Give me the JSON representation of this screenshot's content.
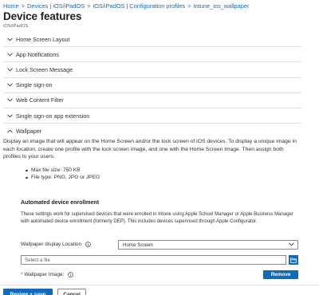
{
  "breadcrumb": {
    "items": [
      "Home",
      "Devices | iOS/iPadOS",
      "iOS/iPadOS | Configuration profiles",
      "Intune_ios_wallpaper"
    ],
    "separator": ">"
  },
  "page": {
    "title": "Device features",
    "subtitle": "iOS/iPadOS"
  },
  "sections": [
    {
      "label": "Home Screen Layout",
      "expanded": false
    },
    {
      "label": "App Notifications",
      "expanded": false
    },
    {
      "label": "Lock Screen Message",
      "expanded": false
    },
    {
      "label": "Single sign-on",
      "expanded": false
    },
    {
      "label": "Web Content Filter",
      "expanded": false
    },
    {
      "label": "Single sign-on app extension",
      "expanded": false
    },
    {
      "label": "Wallpaper",
      "expanded": true
    }
  ],
  "wallpaper": {
    "description": "Display an image that will appear on the Home Screen and/or the lock screen of iOS devices. To display a unique image in each location, create one profile with the lock screen image, and one with the Home Screen image. Then assign both profiles to your users.",
    "bullets": [
      "Max file size: 750 KB",
      "File type: PNG, JPG or JPEG"
    ]
  },
  "ade": {
    "heading": "Automated device enrollment",
    "description": "These settings work for supervised devices that were enrolled in Intune using Apple School Manager or Apple Business Manager with automated device enrollment (formerly DEP). This includes devices supervised through Apple Configurator.",
    "location_label": "Wallpaper display Location",
    "location_value": "Home Screen",
    "file_placeholder": "Select a file",
    "image_label": "Wallpaper Image:",
    "remove_label": "Remove"
  },
  "footer": {
    "review_label": "Review + save",
    "cancel_label": "Cancel"
  },
  "colors": {
    "accent": "#0f6cbd",
    "text": "#323130",
    "border": "#e1dfdd",
    "required": "#a4262c"
  },
  "icons": {
    "section_collapsed": "chevron-down-icon",
    "section_expanded": "chevron-up-icon",
    "info": "info-icon",
    "folder": "folder-icon",
    "dropdown": "chevron-down-icon"
  }
}
